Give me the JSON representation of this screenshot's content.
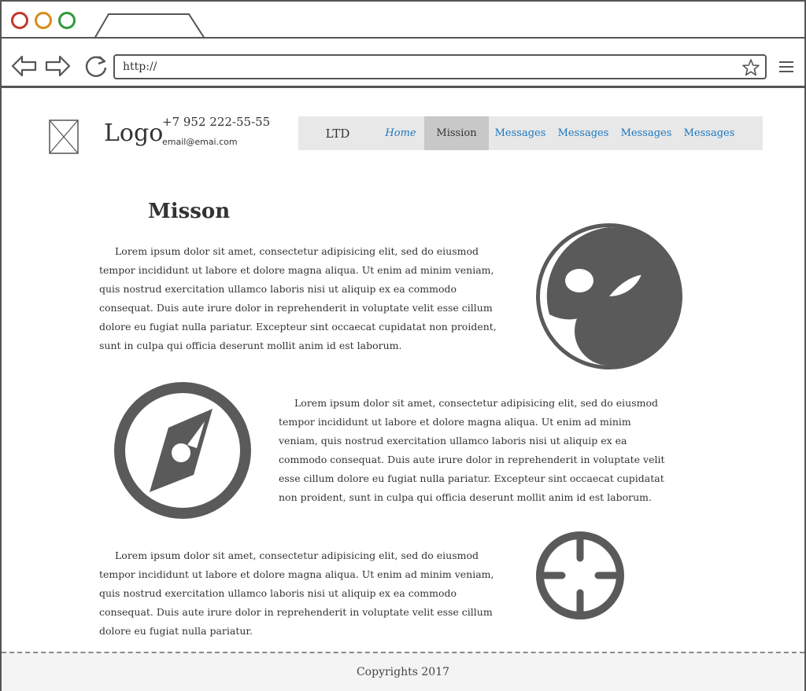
{
  "browser": {
    "url": "http://",
    "icons": [
      "back-arrow-icon",
      "forward-arrow-icon",
      "reload-icon",
      "star-icon",
      "menu-icon"
    ],
    "dot_colors": [
      "#c0392b",
      "#d88c1a",
      "#2e9a3a"
    ]
  },
  "header": {
    "logo": "Logo",
    "phone": "+7 952 222-55-55",
    "email": "email@emai.com"
  },
  "nav": {
    "brand": "LTD",
    "home": "Home",
    "active": "Mission",
    "items": [
      "Messages",
      "Messages",
      "Messages",
      "Messages"
    ],
    "link_color": "#1a78c2"
  },
  "main": {
    "title": "Misson",
    "paragraphs": [
      "Lorem ipsum dolor sit amet, consectetur adipisicing elit, sed do eiusmod tempor incididunt ut labore et dolore magna aliqua. Ut enim ad minim veniam, quis nostrud exercitation ullamco laboris nisi ut aliquip ex ea commodo consequat. Duis aute irure dolor in reprehenderit in voluptate velit esse cillum dolore eu fugiat nulla pariatur. Excepteur sint occaecat cupidatat non proident, sunt in culpa qui officia deserunt mollit anim id est laborum.",
      "Lorem ipsum dolor sit amet, consectetur adipisicing elit, sed do eiusmod tempor incididunt ut labore et dolore magna aliqua. Ut enim ad minim veniam, quis nostrud exercitation ullamco laboris nisi ut aliquip ex ea commodo consequat. Duis aute irure dolor in reprehenderit in voluptate velit esse cillum dolore eu fugiat nulla pariatur. Excepteur sint occaecat cupidatat non proident, sunt in culpa qui officia deserunt mollit anim id est laborum.",
      "Lorem ipsum dolor sit amet, consectetur adipisicing elit, sed do eiusmod tempor incididunt ut labore et dolore magna aliqua. Ut enim ad minim veniam, quis nostrud exercitation ullamco laboris nisi ut aliquip ex ea commodo consequat. Duis aute irure dolor in reprehenderit in voluptate velit esse cillum dolore eu fugiat nulla pariatur."
    ],
    "icons": [
      "yin-yang-icon",
      "compass-icon",
      "crosshair-icon"
    ]
  },
  "footer": {
    "copyright": "Copyrights 2017"
  }
}
